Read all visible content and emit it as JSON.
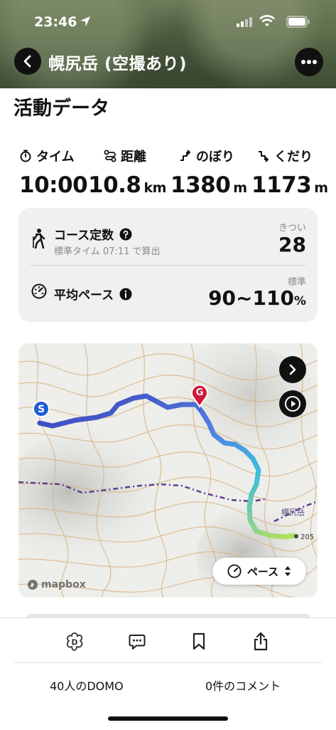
{
  "status_bar": {
    "time": "23:46"
  },
  "header": {
    "title": "幌尻岳 (空撮あり)"
  },
  "section_title": "活動データ",
  "stats": [
    {
      "label": "タイム",
      "value": "10:00",
      "unit": ""
    },
    {
      "label": "距離",
      "value": "10.8",
      "unit": "km"
    },
    {
      "label": "のぼり",
      "value": "1380",
      "unit": "m"
    },
    {
      "label": "くだり",
      "value": "1173",
      "unit": "m"
    }
  ],
  "course": {
    "label": "コース定数",
    "sub": "標準タイム 07:11 で算出",
    "tag": "きつい",
    "value": "28"
  },
  "pace": {
    "label": "平均ペース",
    "tag": "標準",
    "value": "90~110",
    "unit": "%"
  },
  "map": {
    "start_marker": "S",
    "goal_marker": "G",
    "peak_label": "幌尻岳",
    "elevation_label": "205",
    "pace_button": "ペース",
    "attribution": "mapbox",
    "route_gradient": [
      "#3b3fb8",
      "#4f7de0",
      "#3fbde0",
      "#b8e05a"
    ]
  },
  "bottom": {
    "domo": "40人のDOMO",
    "comments": "0件のコメント"
  }
}
